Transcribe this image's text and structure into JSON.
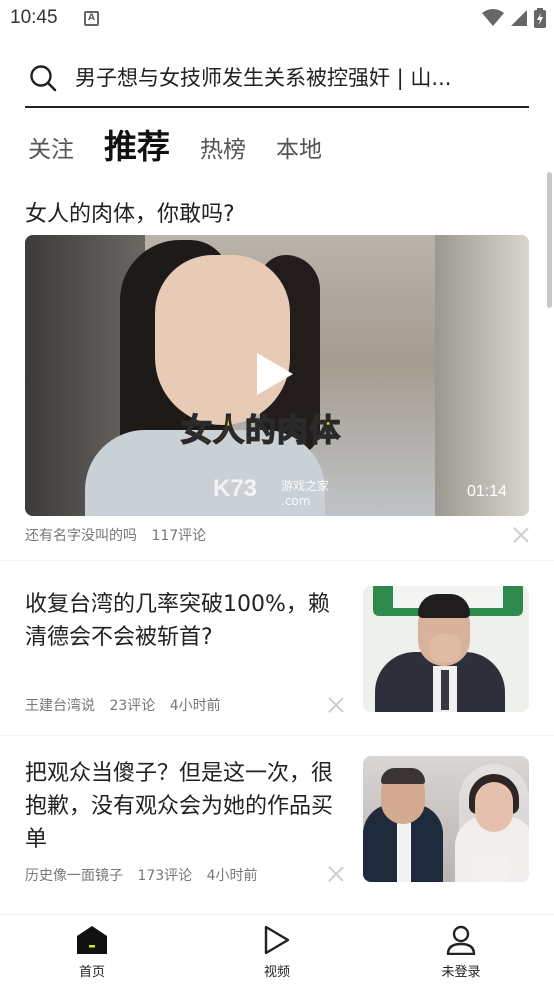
{
  "status_bar": {
    "time": "10:45",
    "a_icon": "A"
  },
  "search": {
    "query": "男子想与女技师发生关系被控强奸 | 山..."
  },
  "tabs": [
    {
      "label": "关注",
      "active": false
    },
    {
      "label": "推荐",
      "active": true
    },
    {
      "label": "热榜",
      "active": false
    },
    {
      "label": "本地",
      "active": false
    }
  ],
  "video": {
    "title": "女人的肉体，你敢吗?",
    "caption": "女人的肉体",
    "watermark": "K73",
    "watermark_small": "游戏之家",
    "watermark_com": ".com",
    "duration": "01:14",
    "author": "还有名字没叫的吗",
    "comments": "117评论"
  },
  "news": [
    {
      "title": "收复台湾的几率突破100%，赖清德会不会被斩首?",
      "author": "王建台湾说",
      "comments": "23评论",
      "time": "4小时前"
    },
    {
      "title": "把观众当傻子？但是这一次，很抱歉，没有观众会为她的作品买单",
      "author": "历史像一面镜子",
      "comments": "173评论",
      "time": "4小时前"
    }
  ],
  "bottom_nav": [
    {
      "label": "首页",
      "icon": "home-icon",
      "active": true
    },
    {
      "label": "视频",
      "icon": "play-icon",
      "active": false
    },
    {
      "label": "未登录",
      "icon": "user-icon",
      "active": false
    }
  ],
  "colors": {
    "accent": "#111111",
    "home_dot": "#c6f000",
    "caption": "#ffd900"
  }
}
